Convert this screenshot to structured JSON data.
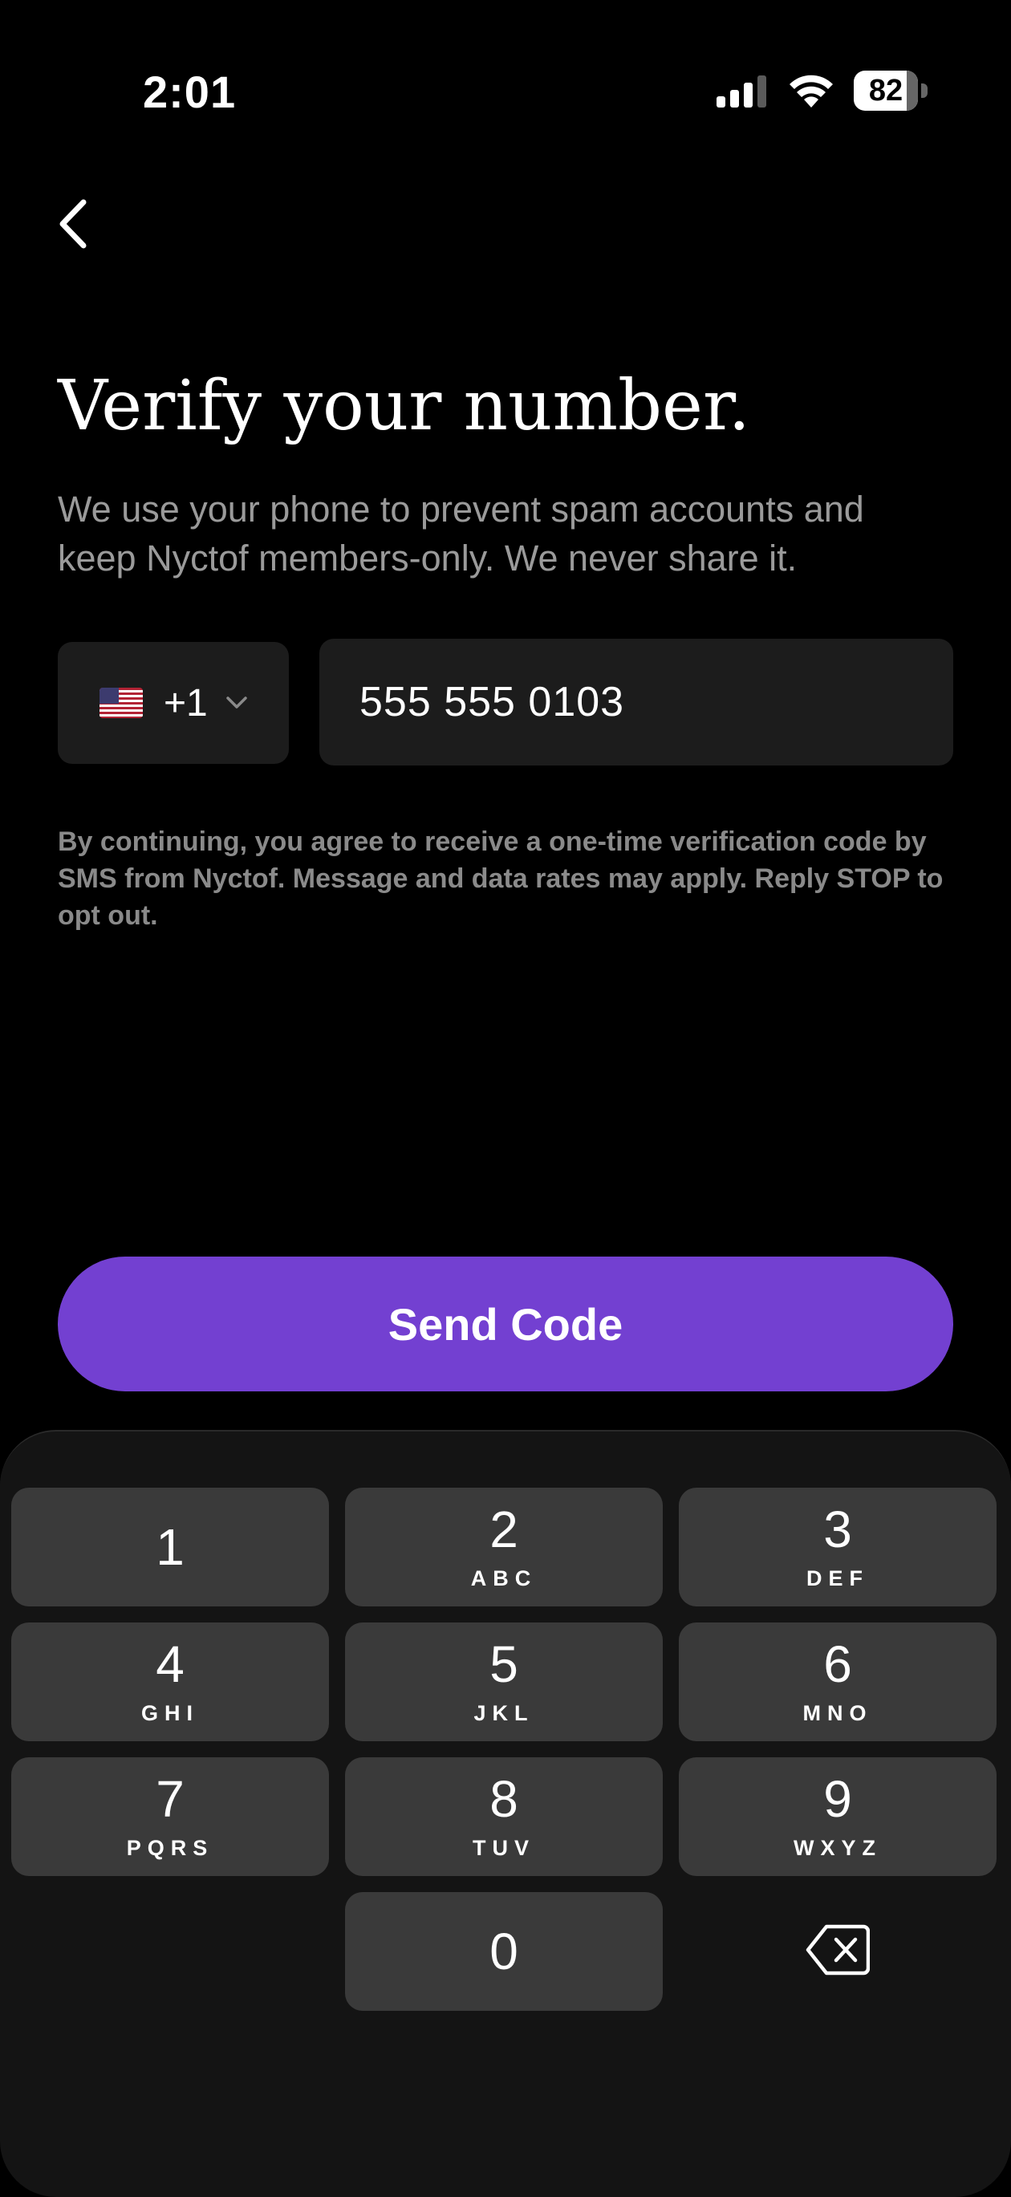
{
  "status_bar": {
    "time": "2:01",
    "battery": "82"
  },
  "header": {
    "title": "Verify your number.",
    "subtitle": "We use your phone to prevent spam accounts and keep Nyctof members-only. We never share it."
  },
  "country": {
    "flag": "us-flag-icon",
    "code": "+1"
  },
  "phone": {
    "value": "555 555 0103"
  },
  "legal": "By continuing, you agree to receive a one-time verification code by SMS from Nyctof. Message and data rates may apply. Reply STOP to opt out.",
  "send_button": {
    "label": "Send Code",
    "color": "#7340d1"
  },
  "keypad": {
    "keys": [
      {
        "num": "1",
        "letters": ""
      },
      {
        "num": "2",
        "letters": "ABC"
      },
      {
        "num": "3",
        "letters": "DEF"
      },
      {
        "num": "4",
        "letters": "GHI"
      },
      {
        "num": "5",
        "letters": "JKL"
      },
      {
        "num": "6",
        "letters": "MNO"
      },
      {
        "num": "7",
        "letters": "PQRS"
      },
      {
        "num": "8",
        "letters": "TUV"
      },
      {
        "num": "9",
        "letters": "WXYZ"
      },
      {
        "num": "0",
        "letters": ""
      }
    ],
    "delete_icon": "backspace-icon"
  }
}
